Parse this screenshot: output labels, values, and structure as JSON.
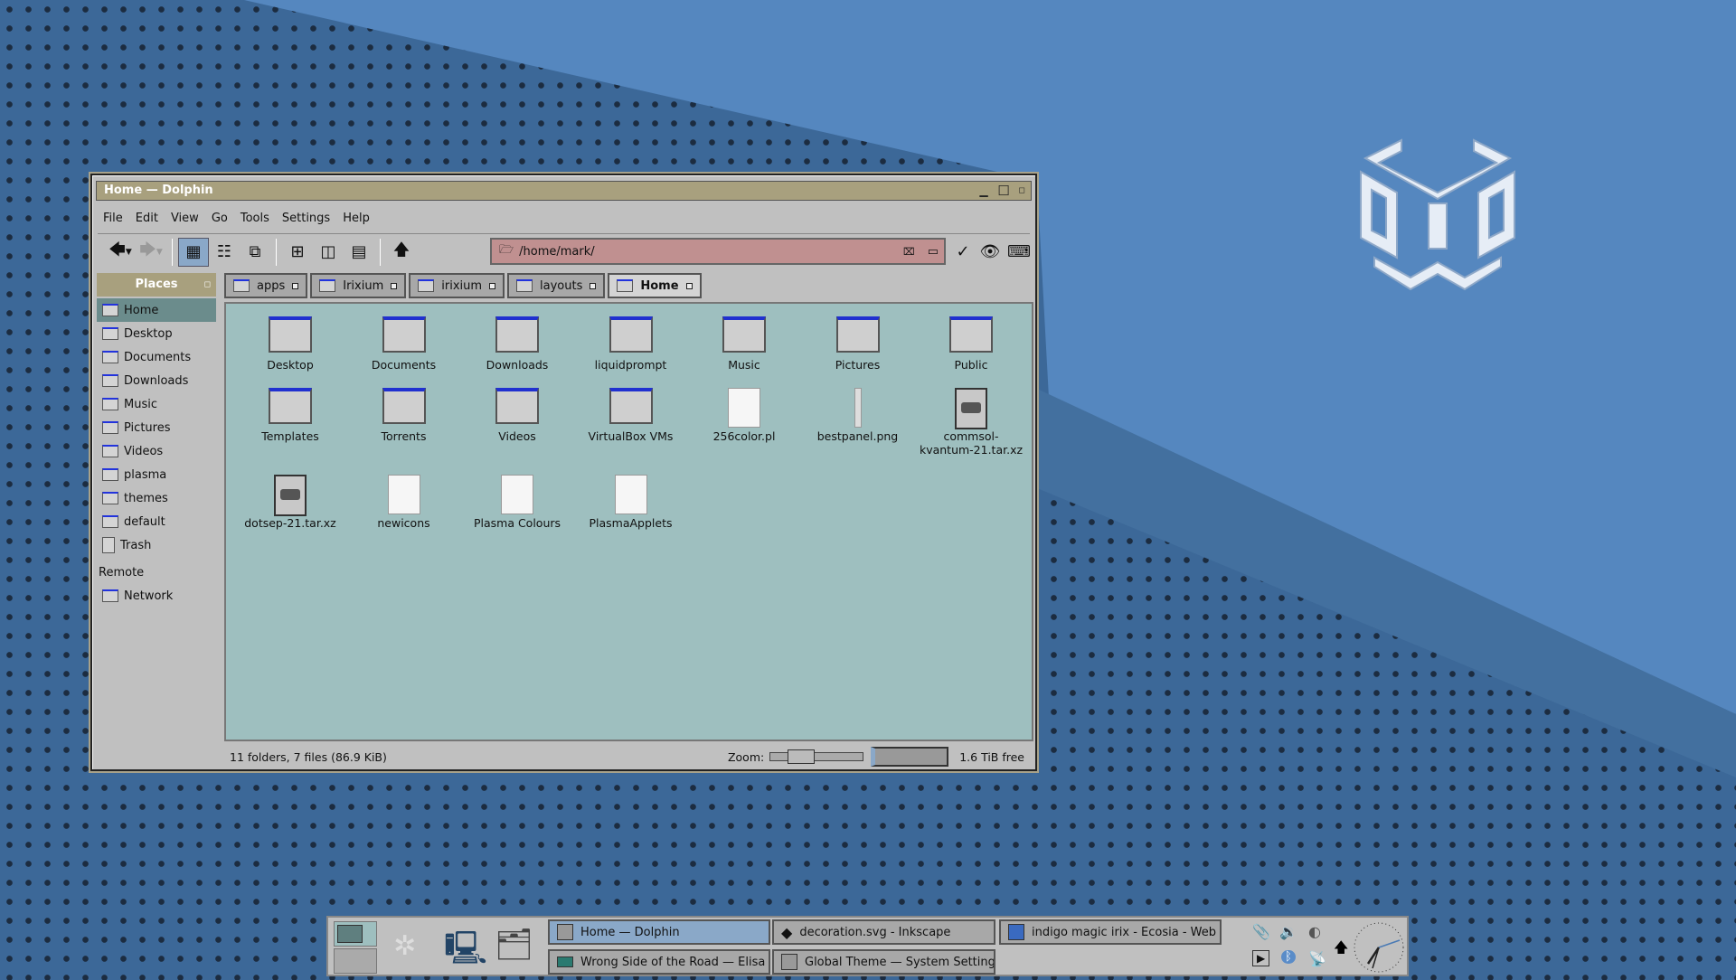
{
  "window": {
    "title": "Home — Dolphin"
  },
  "menu": [
    "File",
    "Edit",
    "View",
    "Go",
    "Tools",
    "Settings",
    "Help"
  ],
  "location": {
    "path": "/home/mark/"
  },
  "places": {
    "header": "Places",
    "items": [
      {
        "label": "Home",
        "selected": true
      },
      {
        "label": "Desktop"
      },
      {
        "label": "Documents"
      },
      {
        "label": "Downloads"
      },
      {
        "label": "Music"
      },
      {
        "label": "Pictures"
      },
      {
        "label": "Videos"
      },
      {
        "label": "plasma"
      },
      {
        "label": "themes"
      },
      {
        "label": "default"
      },
      {
        "label": "Trash"
      }
    ],
    "remote_header": "Remote",
    "remote_items": [
      {
        "label": "Network"
      }
    ]
  },
  "tabs": [
    {
      "label": "apps"
    },
    {
      "label": "Irixium"
    },
    {
      "label": "irixium"
    },
    {
      "label": "layouts"
    },
    {
      "label": "Home",
      "active": true
    }
  ],
  "files": [
    {
      "name": "Desktop",
      "kind": "folder"
    },
    {
      "name": "Documents",
      "kind": "folder"
    },
    {
      "name": "Downloads",
      "kind": "folder"
    },
    {
      "name": "liquidprompt",
      "kind": "folder"
    },
    {
      "name": "Music",
      "kind": "folder"
    },
    {
      "name": "Pictures",
      "kind": "folder"
    },
    {
      "name": "Public",
      "kind": "folder"
    },
    {
      "name": "Templates",
      "kind": "folder"
    },
    {
      "name": "Torrents",
      "kind": "folder"
    },
    {
      "name": "Videos",
      "kind": "folder"
    },
    {
      "name": "VirtualBox VMs",
      "kind": "folder"
    },
    {
      "name": "256color.pl",
      "kind": "file"
    },
    {
      "name": "bestpanel.png",
      "kind": "image"
    },
    {
      "name": "commsol-kvantum-21.tar.xz",
      "kind": "archive"
    },
    {
      "name": "dotsep-21.tar.xz",
      "kind": "archive"
    },
    {
      "name": "newicons",
      "kind": "file"
    },
    {
      "name": "Plasma Colours",
      "kind": "file"
    },
    {
      "name": "PlasmaApplets",
      "kind": "file"
    }
  ],
  "status": {
    "summary": "11 folders, 7 files (86.9 KiB)",
    "zoom_label": "Zoom:",
    "zoom_level": 0.25,
    "free": "1.6 TiB free"
  },
  "taskbar": {
    "tasks": [
      {
        "label": "Home — Dolphin",
        "active": true
      },
      {
        "label": "decoration.svg - Inkscape"
      },
      {
        "label": "indigo magic irix - Ecosia - Web - Vi..."
      },
      {
        "label": "Wrong Side of the Road — Elisa"
      },
      {
        "label": "Global Theme  — System Settings"
      }
    ]
  },
  "colors": {
    "titlebar": "#a8a07e",
    "content_bg": "#9ebfbf",
    "location_bg": "#c09090",
    "selection": "#8aa8c8"
  }
}
